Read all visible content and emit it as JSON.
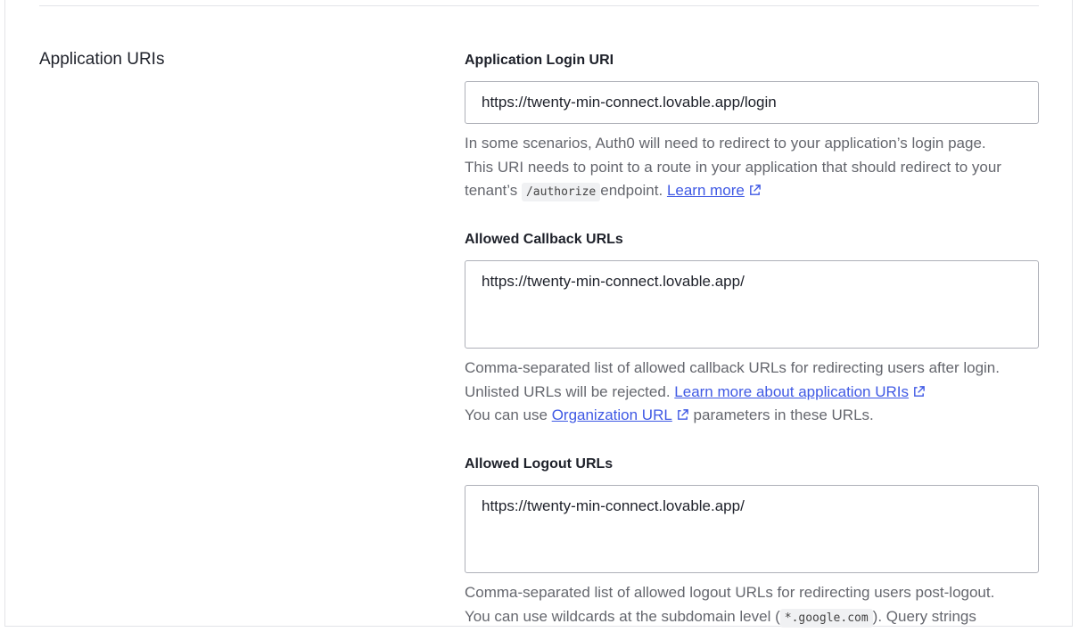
{
  "section": {
    "title": "Application URIs"
  },
  "login_uri": {
    "label": "Application Login URI",
    "value": "https://twenty-min-connect.lovable.app/login",
    "help_line1": "In some scenarios, Auth0 will need to redirect to your application’s login page.",
    "help_line2": "This URI needs to point to a route in your application that should redirect to your",
    "help_line3_pre": "tenant’s",
    "help_code": "/authorize",
    "help_line3_post": "endpoint.",
    "help_link": "Learn more"
  },
  "callback_urls": {
    "label": "Allowed Callback URLs",
    "value": "https://twenty-min-connect.lovable.app/",
    "help_line1": "Comma-separated list of allowed callback URLs for redirecting users after login.",
    "help_line2_pre": "Unlisted URLs will be rejected.",
    "help_link1": "Learn more about application URIs",
    "help_line3_pre": "You can use",
    "help_link2": "Organization URL",
    "help_line3_post": "parameters in these URLs."
  },
  "logout_urls": {
    "label": "Allowed Logout URLs",
    "value": "https://twenty-min-connect.lovable.app/",
    "help_line1": "Comma-separated list of allowed logout URLs for redirecting users post-logout.",
    "help_line2_pre": "You can use wildcards at the subdomain level (",
    "help_code": "*.google.com",
    "help_line2_post": "). Query strings"
  },
  "icons": {
    "external_link": "external-link-icon"
  },
  "colors": {
    "link": "#3f59e4",
    "help_text": "#65676e",
    "border": "#aeb0b8"
  }
}
